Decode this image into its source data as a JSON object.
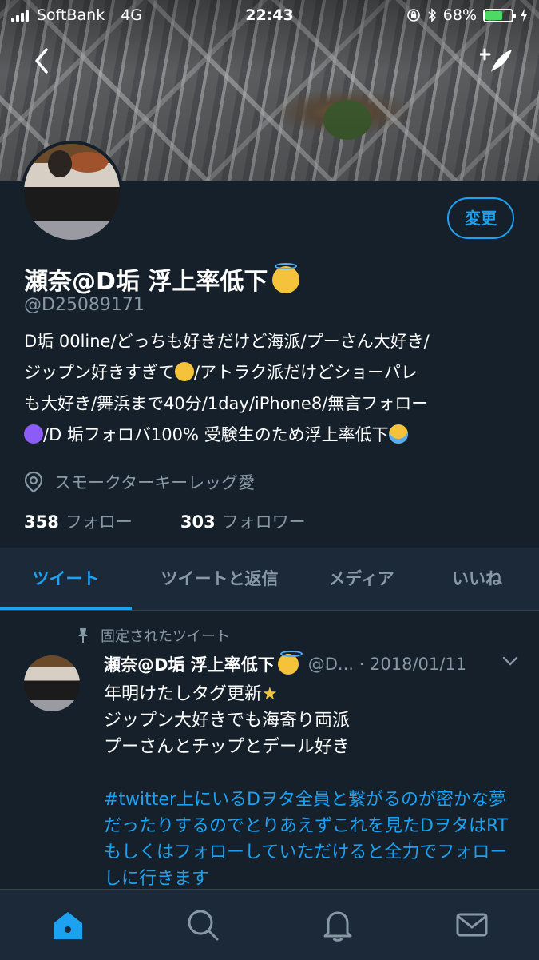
{
  "status_bar": {
    "carrier": "SoftBank",
    "network": "4G",
    "time": "22:43",
    "battery": "68%",
    "battery_level": 0.68
  },
  "profile": {
    "edit_label": "変更",
    "display_name": "瀬奈@D垢 浮上率低下",
    "handle": "@D25089171",
    "bio_lines": [
      "D垢 00line/どっちも好きだけど海派/プーさん大好き/",
      "ジップン好きすぎて",
      "/アトラク派だけどショーパレ",
      "も大好き/舞浜まで40分/1day/iPhone8/無言フォロー",
      "/D 垢フォロバ100% 受験生のため浮上率低下"
    ],
    "location": "スモークターキーレッグ愛",
    "following_count": "358",
    "following_label": "フォロー",
    "followers_count": "303",
    "followers_label": "フォロワー"
  },
  "tabs": [
    {
      "label": "ツイート"
    },
    {
      "label": "ツイートと返信"
    },
    {
      "label": "メディア"
    },
    {
      "label": "いいね"
    }
  ],
  "tweet": {
    "pinned_label": "固定されたツイート",
    "author_name": "瀬奈@D垢 浮上率低下",
    "handle_truncated": "@D...",
    "date": "2018/01/11",
    "separator": "·",
    "line1": "年明けたしタグ更新",
    "line2": "ジップン大好きでも海寄り両派",
    "line3": "プーさんとチップとデール好き",
    "hashtag_text": "#twitter上にいるDヲタ全員と繋がるのが密かな夢だったりするのでとりあえずこれを見たDヲタはRTもしくはフォローしていただけると全力でフォローしに行きます"
  },
  "colors": {
    "background": "#15202b",
    "accent": "#1da1f2",
    "secondary_text": "#8899a6",
    "battery": "#4cd964"
  },
  "icons": {
    "back": "chevron-left-icon",
    "compose": "compose-icon",
    "location": "location-pin-icon",
    "pin": "pin-icon",
    "home": "home-icon",
    "search": "search-icon",
    "notifications": "bell-icon",
    "messages": "mail-icon"
  }
}
